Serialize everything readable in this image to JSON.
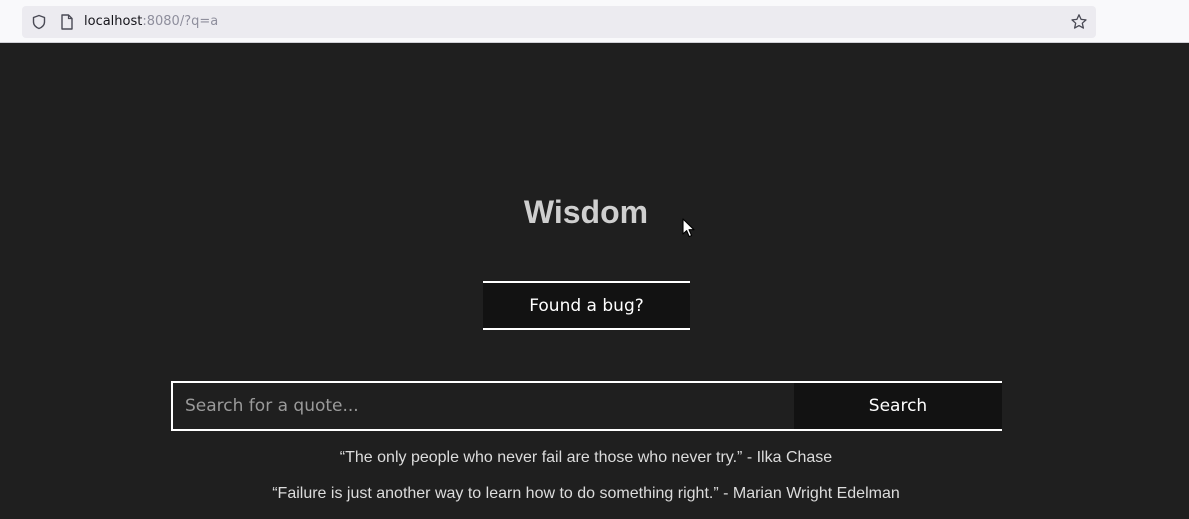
{
  "browser": {
    "url_host": "localhost",
    "url_rest": ":8080/?q=a",
    "icons": {
      "security": "shield-icon",
      "page": "page-icon",
      "bookmark": "star-icon"
    }
  },
  "app": {
    "title": "Wisdom",
    "bug_button_label": "Found a bug?",
    "search": {
      "placeholder": "Search for a quote...",
      "value": "",
      "button_label": "Search"
    },
    "quotes": [
      "“The only people who never fail are those who never try.” - Ilka Chase",
      "“Failure is just another way to learn how to do something right.” - Marian Wright Edelman"
    ]
  },
  "colors": {
    "page_background": "#1f1f1f",
    "button_background": "#121212",
    "title": "#cfcfcf",
    "border": "#ffffff"
  }
}
